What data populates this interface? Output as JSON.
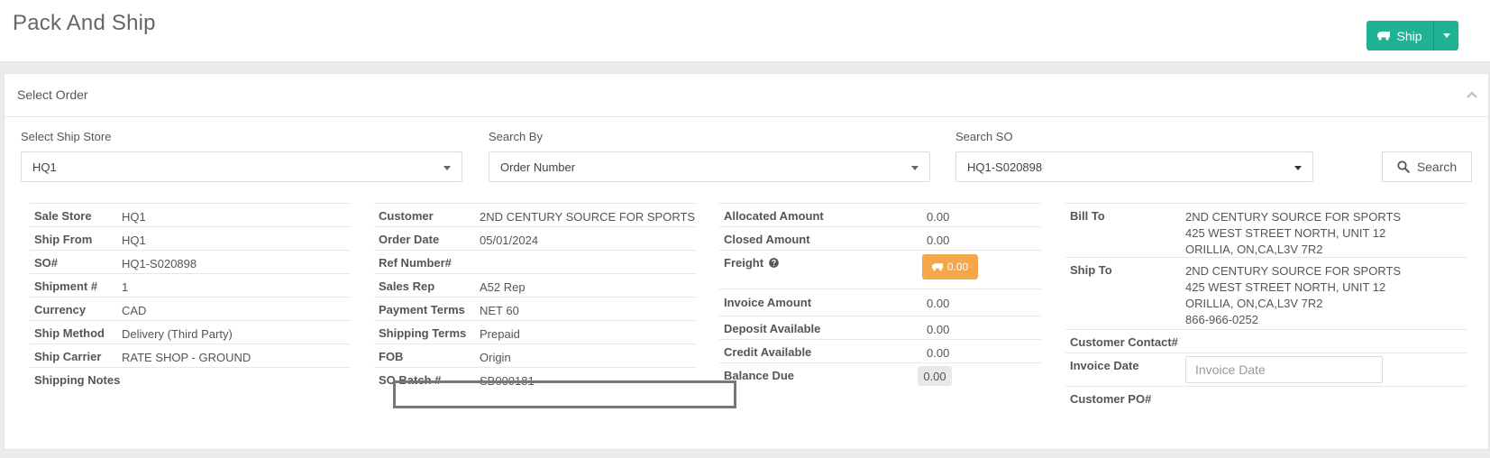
{
  "header": {
    "title": "Pack And Ship",
    "ship_label": "Ship"
  },
  "panel": {
    "title": "Select Order"
  },
  "filters": {
    "ship_store": {
      "label": "Select Ship Store",
      "value": "HQ1"
    },
    "search_by": {
      "label": "Search By",
      "value": "Order Number"
    },
    "search_so": {
      "label": "Search SO",
      "value": "HQ1-S020898"
    },
    "search_button": "Search"
  },
  "order_info": {
    "sale_store": {
      "label": "Sale Store",
      "value": "HQ1"
    },
    "ship_from": {
      "label": "Ship From",
      "value": "HQ1"
    },
    "so_number": {
      "label": "SO#",
      "value": "HQ1-S020898"
    },
    "shipment": {
      "label": "Shipment #",
      "value": "1"
    },
    "currency": {
      "label": "Currency",
      "value": "CAD"
    },
    "ship_method": {
      "label": "Ship Method",
      "value": "Delivery (Third Party)"
    },
    "ship_carrier": {
      "label": "Ship Carrier",
      "value": "RATE SHOP - GROUND"
    },
    "shipping_notes": {
      "label": "Shipping Notes",
      "value": ""
    }
  },
  "customer_info": {
    "customer": {
      "label": "Customer",
      "value": "2ND CENTURY SOURCE FOR SPORTS"
    },
    "order_date": {
      "label": "Order Date",
      "value": "05/01/2024"
    },
    "ref_number": {
      "label": "Ref Number#",
      "value": ""
    },
    "sales_rep": {
      "label": "Sales Rep",
      "value": "A52 Rep"
    },
    "payment_terms": {
      "label": "Payment Terms",
      "value": "NET 60"
    },
    "shipping_terms": {
      "label": "Shipping Terms",
      "value": "Prepaid"
    },
    "fob": {
      "label": "FOB",
      "value": "Origin"
    },
    "so_batch": {
      "label": "SO Batch #",
      "value": "SB000181"
    }
  },
  "amounts": {
    "allocated": {
      "label": "Allocated Amount",
      "value": "0.00"
    },
    "closed": {
      "label": "Closed Amount",
      "value": "0.00"
    },
    "freight": {
      "label": "Freight",
      "value": "0.00"
    },
    "invoice": {
      "label": "Invoice Amount",
      "value": "0.00"
    },
    "deposit": {
      "label": "Deposit Available",
      "value": "0.00"
    },
    "credit": {
      "label": "Credit Available",
      "value": "0.00"
    },
    "balance": {
      "label": "Balance Due",
      "value": "0.00"
    }
  },
  "addresses": {
    "bill_to": {
      "label": "Bill To",
      "lines": [
        "2ND CENTURY SOURCE FOR SPORTS",
        "425 WEST STREET NORTH, UNIT 12",
        "ORILLIA, ON,CA,L3V 7R2"
      ]
    },
    "ship_to": {
      "label": "Ship To",
      "lines": [
        "2ND CENTURY SOURCE FOR SPORTS",
        "425 WEST STREET NORTH, UNIT 12",
        "ORILLIA, ON,CA,L3V 7R2",
        "866-966-0252"
      ]
    },
    "customer_contact": {
      "label": "Customer Contact#",
      "value": ""
    },
    "invoice_date": {
      "label": "Invoice Date",
      "placeholder": "Invoice Date"
    },
    "customer_po": {
      "label": "Customer PO#",
      "value": ""
    }
  },
  "colors": {
    "ship_button": "#1fb394",
    "freight_button": "#f5a64a",
    "highlight_border": "#777777"
  }
}
